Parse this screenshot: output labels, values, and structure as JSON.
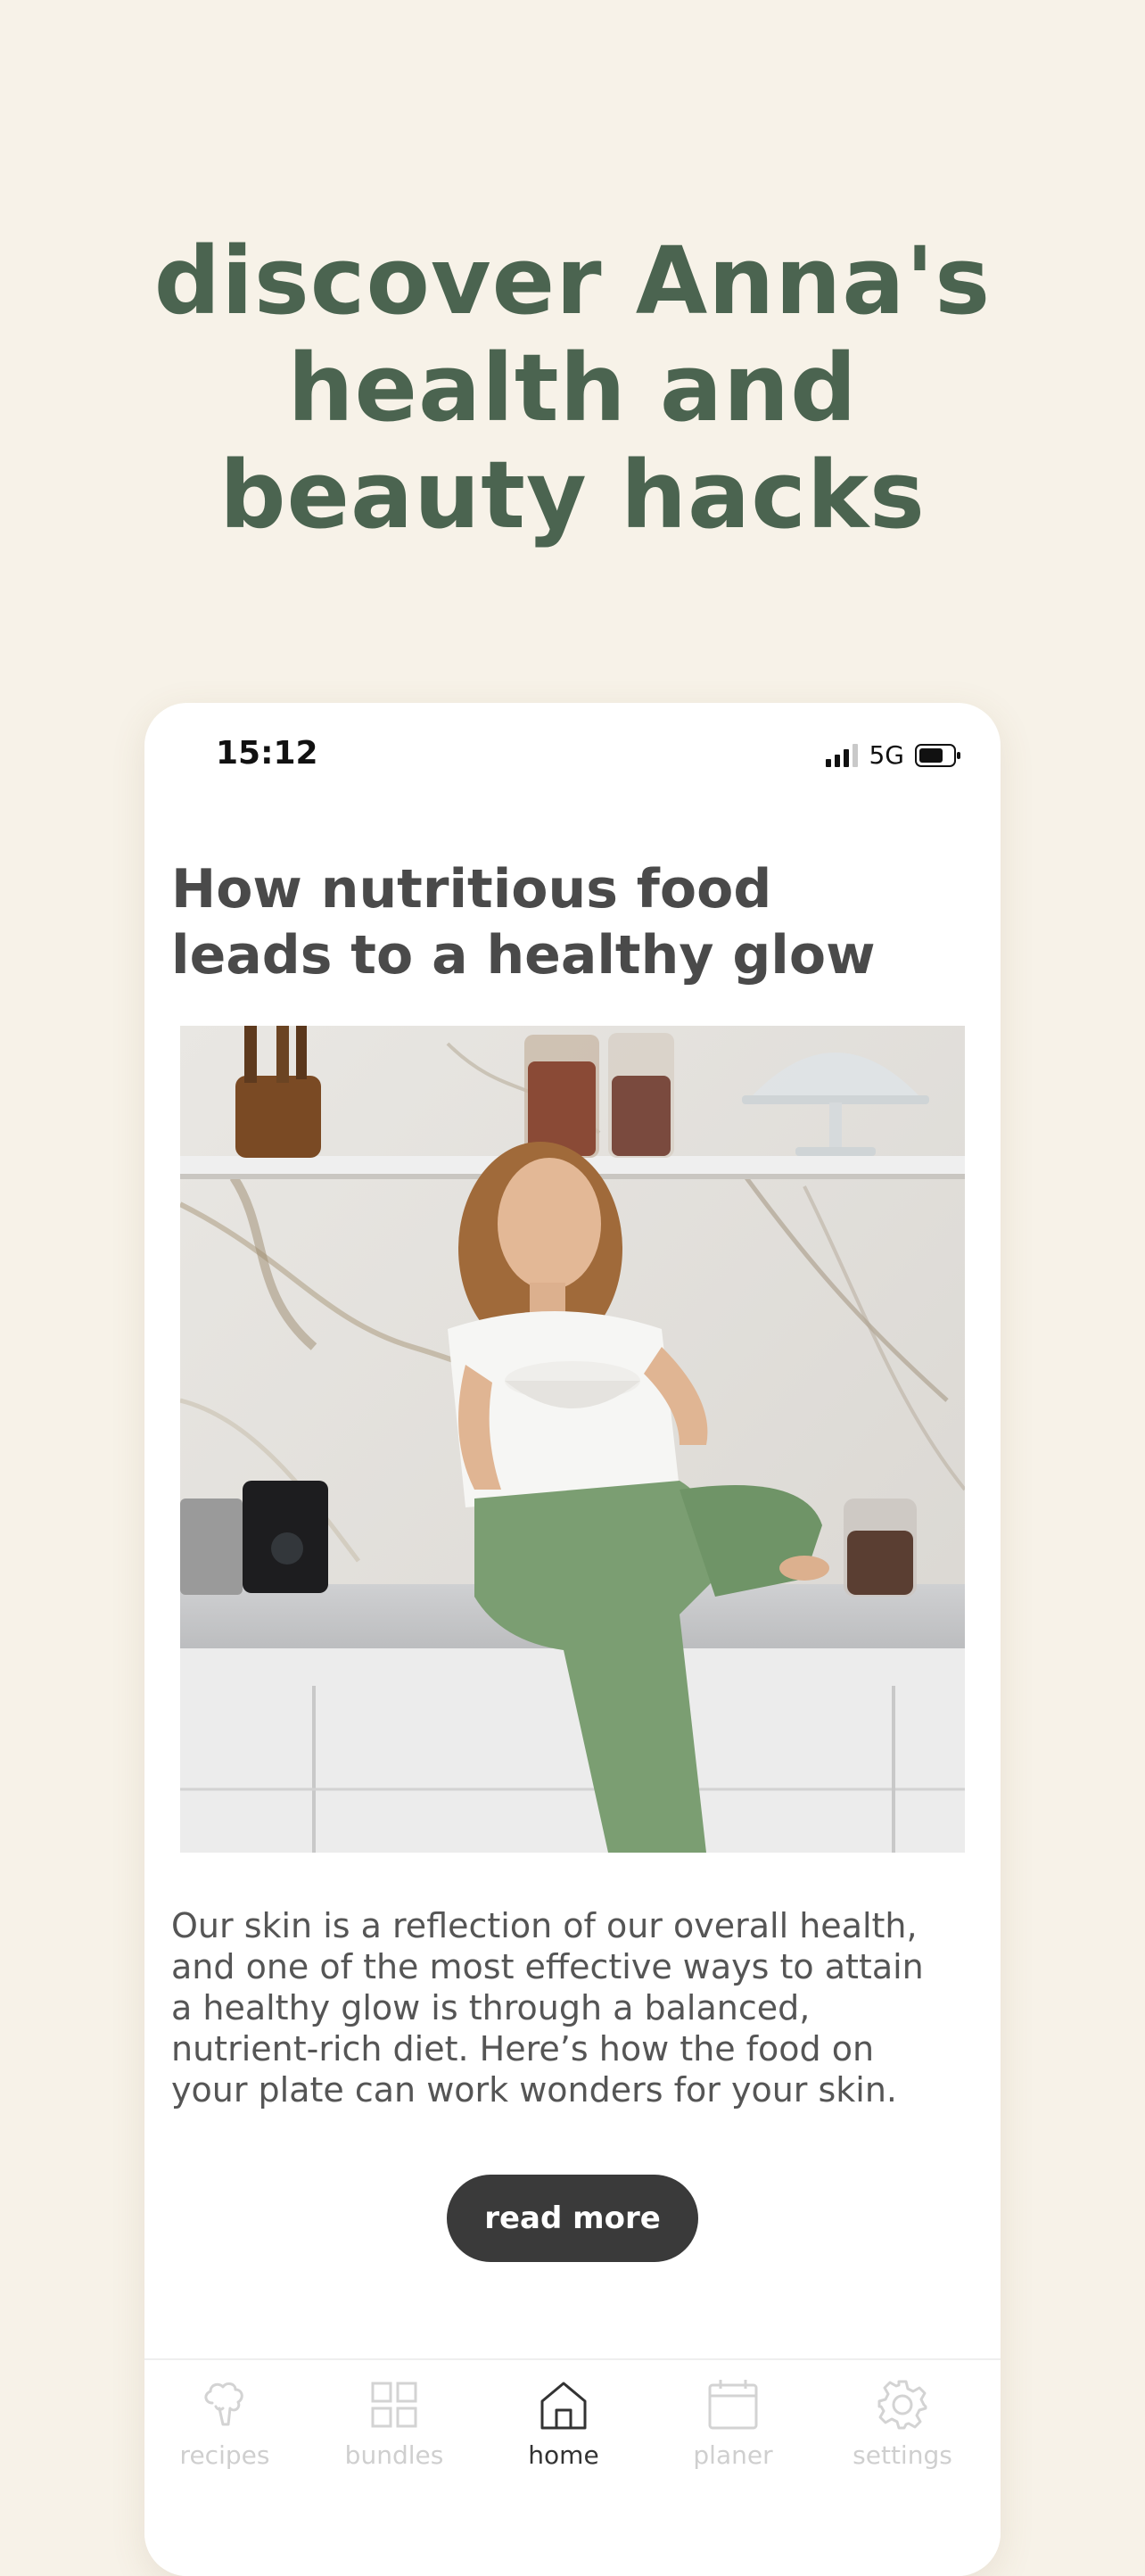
{
  "headline": {
    "lines": [
      "discover Anna's",
      "health and",
      "beauty hacks"
    ]
  },
  "status_bar": {
    "time": "15:12",
    "network": "5G"
  },
  "article": {
    "title_lines": [
      "How nutritious food",
      "leads to a healthy glow"
    ],
    "body_lines": [
      "Our skin is a reflection of our overall health,",
      "and one of the most effective ways to attain",
      "a healthy glow is through a balanced,",
      "nutrient-rich diet. Here’s how the food on",
      "your plate can work wonders for your skin."
    ],
    "read_more_label": "read more"
  },
  "tabbar": {
    "tabs": [
      {
        "label": "recipes",
        "icon": "broccoli-icon",
        "active": false
      },
      {
        "label": "bundles",
        "icon": "grid-icon",
        "active": false
      },
      {
        "label": "home",
        "icon": "home-icon",
        "active": true
      },
      {
        "label": "planer",
        "icon": "calendar-icon",
        "active": false
      },
      {
        "label": "settings",
        "icon": "gear-icon",
        "active": false
      }
    ]
  },
  "colors": {
    "background": "#f7f2e8",
    "headline": "#4b6450",
    "button": "#3a3a3a",
    "tab_active": "#333333",
    "tab_inactive": "#cfcfcf"
  }
}
